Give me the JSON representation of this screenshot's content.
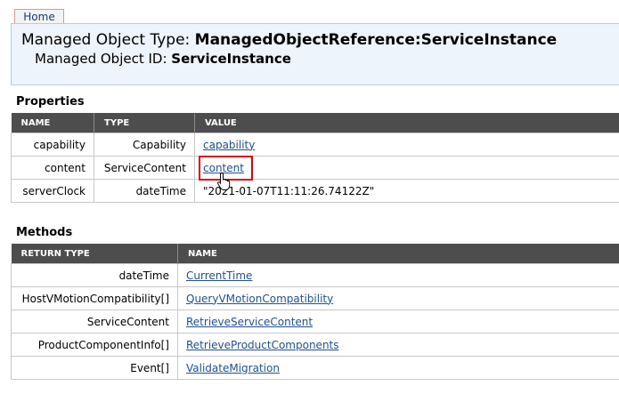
{
  "nav": {
    "home_label": "Home"
  },
  "header": {
    "type_prefix": "Managed Object Type: ",
    "type_value": "ManagedObjectReference:ServiceInstance",
    "id_prefix": "Managed Object ID: ",
    "id_value": "ServiceInstance"
  },
  "properties": {
    "title": "Properties",
    "columns": [
      "NAME",
      "TYPE",
      "VALUE"
    ],
    "rows": [
      {
        "name": "capability",
        "type": "Capability",
        "value": "capability",
        "is_link": true
      },
      {
        "name": "content",
        "type": "ServiceContent",
        "value": "content",
        "is_link": true
      },
      {
        "name": "serverClock",
        "type": "dateTime",
        "value": "\"2021-01-07T11:11:26.74122Z\"",
        "is_link": false
      }
    ]
  },
  "methods": {
    "title": "Methods",
    "columns": [
      "RETURN TYPE",
      "NAME"
    ],
    "rows": [
      {
        "return_type": "dateTime",
        "name": "CurrentTime"
      },
      {
        "return_type": "HostVMotionCompatibility[]",
        "name": "QueryVMotionCompatibility"
      },
      {
        "return_type": "ServiceContent",
        "name": "RetrieveServiceContent"
      },
      {
        "return_type": "ProductComponentInfo[]",
        "name": "RetrieveProductComponents"
      },
      {
        "return_type": "Event[]",
        "name": "ValidateMigration"
      }
    ]
  },
  "colors": {
    "header_bg": "#eef4fb",
    "table_header_bg": "#4d4d4d",
    "link": "#1f4f91",
    "highlight": "#e00000"
  },
  "icons": {
    "cursor": "hand-pointer-icon"
  }
}
